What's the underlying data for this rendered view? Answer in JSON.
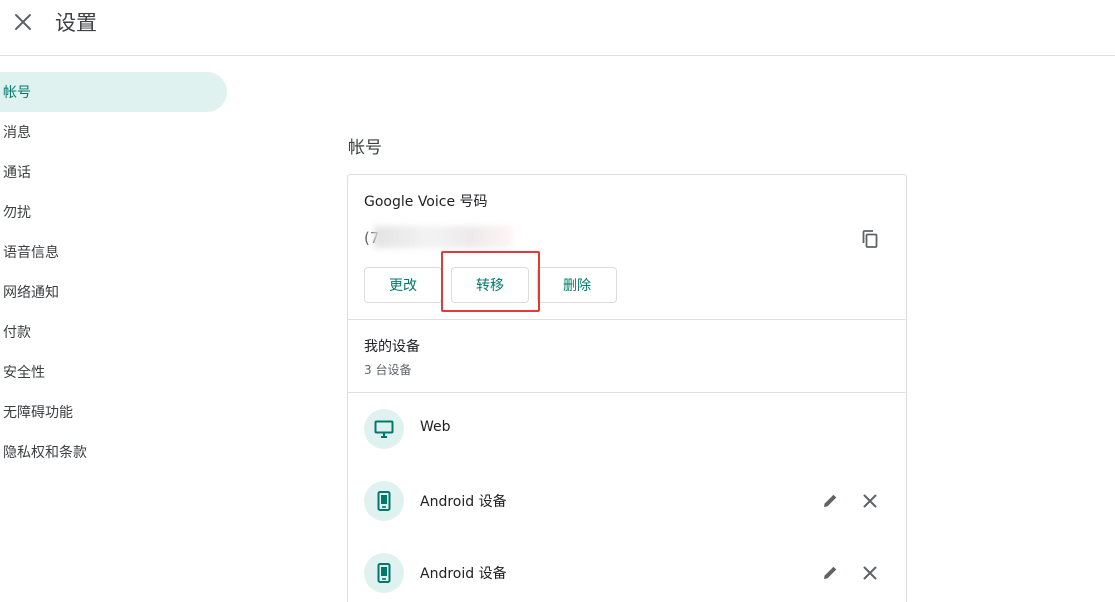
{
  "header": {
    "title": "设置"
  },
  "sidebar": {
    "items": [
      {
        "label": "帐号"
      },
      {
        "label": "消息"
      },
      {
        "label": "通话"
      },
      {
        "label": "勿扰"
      },
      {
        "label": "语音信息"
      },
      {
        "label": "网络通知"
      },
      {
        "label": "付款"
      },
      {
        "label": "安全性"
      },
      {
        "label": "无障碍功能"
      },
      {
        "label": "隐私权和条款"
      }
    ],
    "active": "帐号"
  },
  "account": {
    "section_title": "帐号",
    "gv_title": "Google Voice 号码",
    "phone_visible": "(7",
    "buttons": {
      "change": "更改",
      "transfer": "转移",
      "delete": "删除"
    },
    "devices_title": "我的设备",
    "devices_count": "3 台设备",
    "devices": [
      {
        "name": "Web",
        "icon": "monitor-icon"
      },
      {
        "name": "Android 设备",
        "icon": "phone-icon"
      },
      {
        "name": "Android 设备",
        "icon": "phone-icon"
      }
    ]
  },
  "colors": {
    "accent": "#00796b",
    "active_bg": "#e0f2f0",
    "highlight": "#e53935",
    "divider": "#e0e0e0"
  }
}
